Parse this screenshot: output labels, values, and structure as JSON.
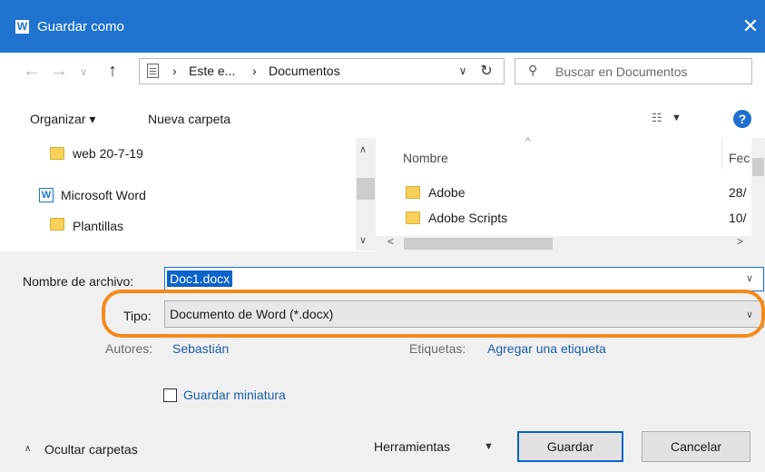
{
  "window": {
    "title": "Guardar como",
    "app_badge": "W",
    "close_glyph": "✕"
  },
  "address": {
    "crumbs": [
      "Este e...",
      "Documentos"
    ],
    "separator": "›",
    "search_placeholder": "Buscar en Documentos"
  },
  "toolbar": {
    "organize_label": "Organizar ▾",
    "new_folder_label": "Nueva carpeta",
    "help_label": "?"
  },
  "tree": {
    "items": [
      {
        "label": "web 20-7-19",
        "icon": "folder-icon"
      },
      {
        "label": "Microsoft Word",
        "icon": "word-icon"
      },
      {
        "label": "Plantillas",
        "icon": "folder-icon"
      }
    ]
  },
  "files": {
    "columns": [
      "Nombre",
      "Fec"
    ],
    "rows": [
      {
        "name": "Adobe",
        "date": "28/"
      },
      {
        "name": "Adobe Scripts",
        "date": "10/"
      }
    ]
  },
  "form": {
    "filename_label": "Nombre de archivo:",
    "filename_value": "Doc1.docx",
    "type_label": "Tipo:",
    "type_value": "Documento de Word (*.docx)",
    "authors_label": "Autores:",
    "authors_value": "Sebastián",
    "tags_label": "Etiquetas:",
    "tags_value": "Agregar una etiqueta",
    "thumbnail_label": "Guardar miniatura"
  },
  "footer": {
    "hide_folders_label": "Ocultar carpetas",
    "tools_label": "Herramientas",
    "save_label": "Guardar",
    "cancel_label": "Cancelar"
  },
  "colors": {
    "title_bar": "#1f73cf",
    "highlight": "#f28a1b",
    "link": "#1a5fa8"
  }
}
